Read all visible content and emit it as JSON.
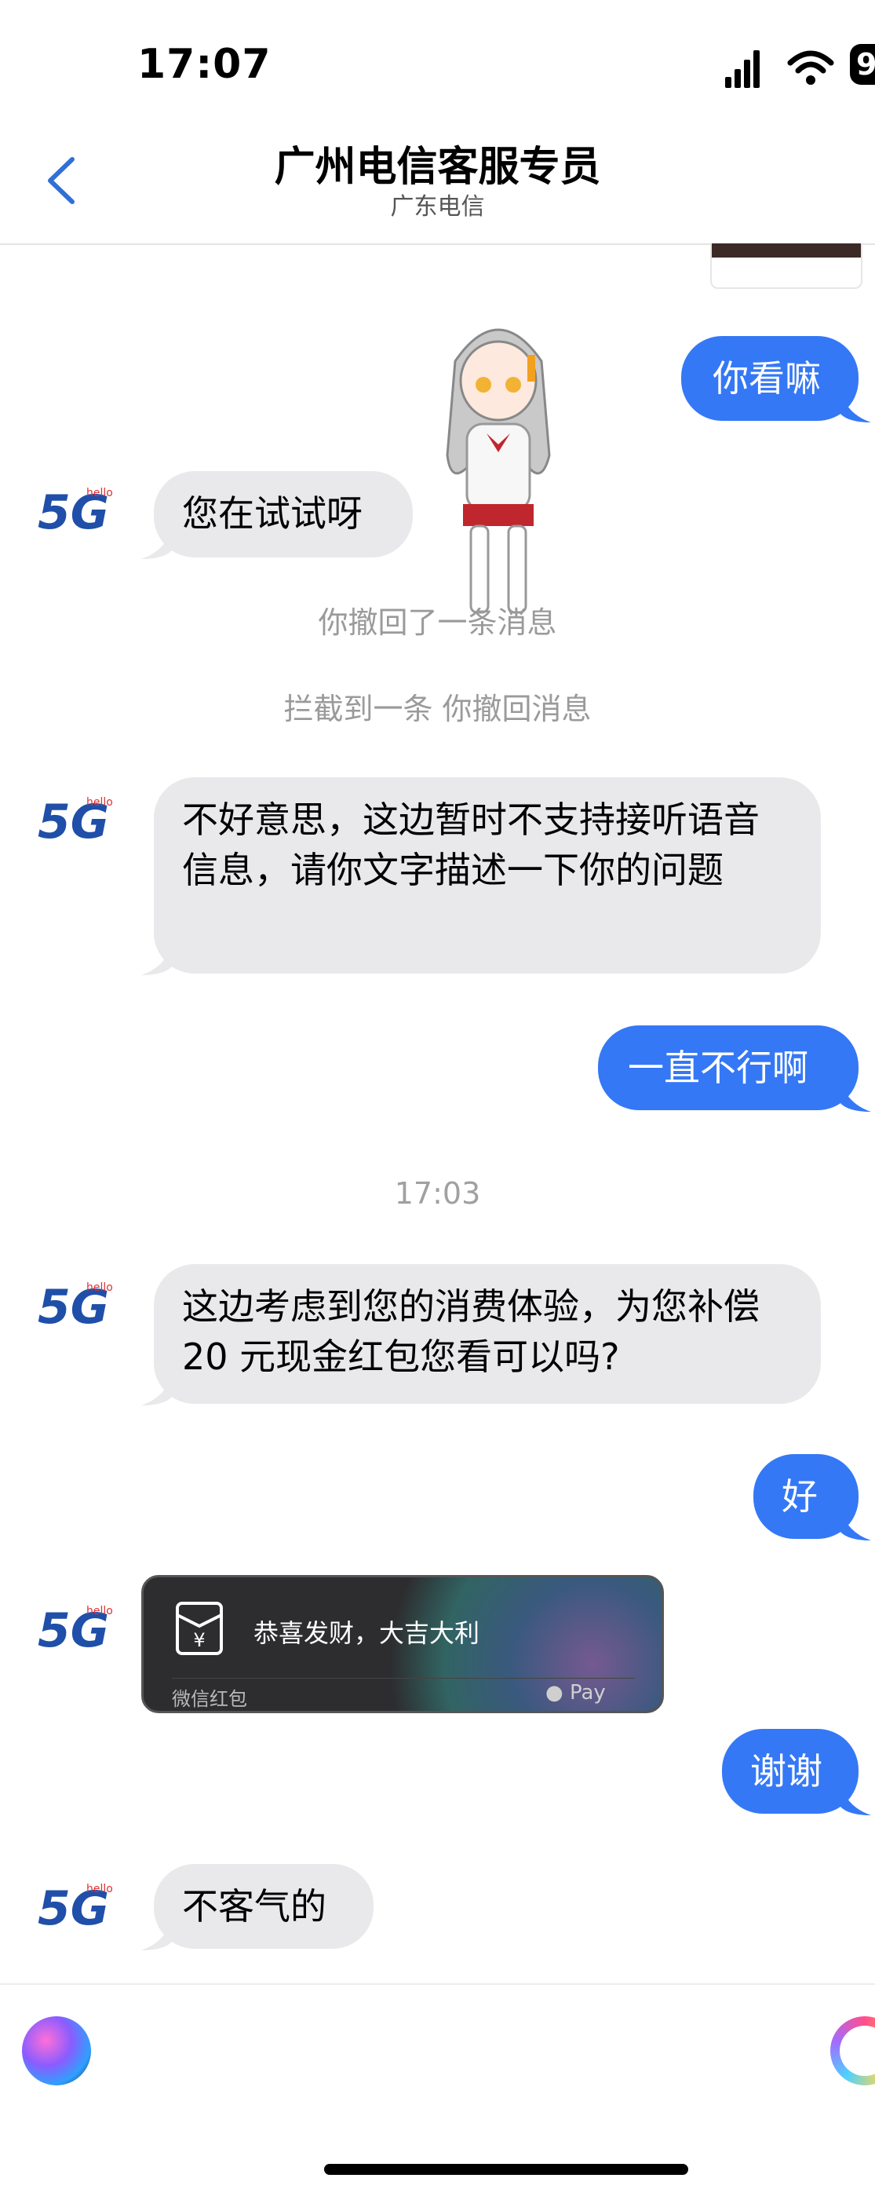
{
  "status_bar": {
    "time": "17:07",
    "battery": "9"
  },
  "header": {
    "title": "广州电信客服专员",
    "subtitle": "广东电信"
  },
  "messages": {
    "m1": "你看嘛",
    "m2": "您在试试呀",
    "sys1": "你撤回了一条消息",
    "sys2": "拦截到一条 你撤回消息",
    "m3": "不好意思，这边暂时不支持接听语音信息，请你文字描述一下你的问题",
    "m4": "一直不行啊",
    "time_divider": "17:03",
    "m5": "这边考虑到您的消费体验，为您补偿 20 元现金红包您看可以吗?",
    "m6": "好",
    "m7": "谢谢",
    "m8": "不客气的"
  },
  "red_packet": {
    "title": "恭喜发财，大吉大利",
    "footer": "微信红包",
    "pay_label": "Pay",
    "currency_symbol": "¥"
  },
  "avatar_text": {
    "main": "5G",
    "small": "hello"
  },
  "colors": {
    "accent": "#3478f6",
    "incoming": "#e9e9eb",
    "back_arrow": "#2f6fd6"
  }
}
